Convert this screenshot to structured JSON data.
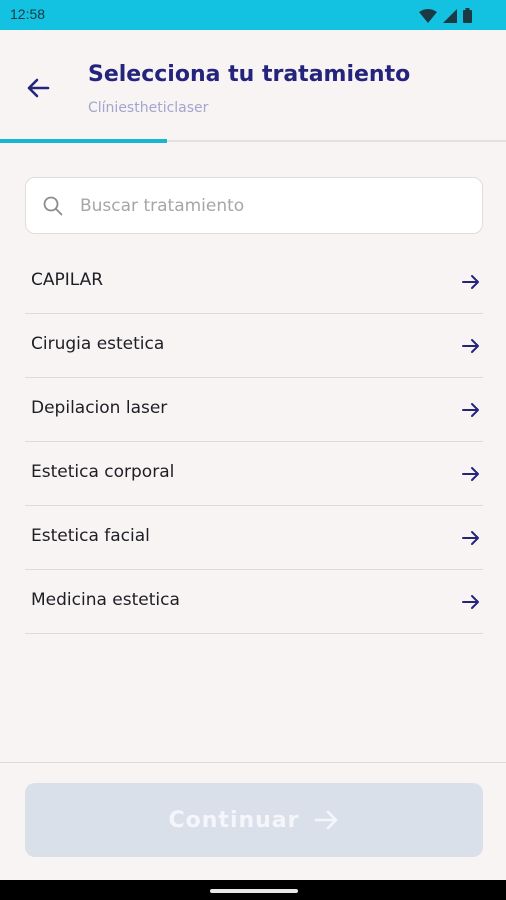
{
  "status_bar": {
    "time": "12:58"
  },
  "header": {
    "title": "Selecciona tu tratamiento",
    "subtitle": "Clíniestheticlaser",
    "progress": 0.33
  },
  "search": {
    "placeholder": "Buscar tratamiento",
    "value": ""
  },
  "treatments": [
    {
      "label": "CAPILAR"
    },
    {
      "label": "Cirugia estetica"
    },
    {
      "label": "Depilacion laser"
    },
    {
      "label": "Estetica corporal"
    },
    {
      "label": "Estetica facial"
    },
    {
      "label": "Medicina estetica"
    }
  ],
  "footer": {
    "continue_label": "Continuar"
  },
  "colors": {
    "accent": "#24247d",
    "status_bar": "#12c2e0",
    "progress": "#17b6d7",
    "button_disabled": "#dae0ea"
  }
}
